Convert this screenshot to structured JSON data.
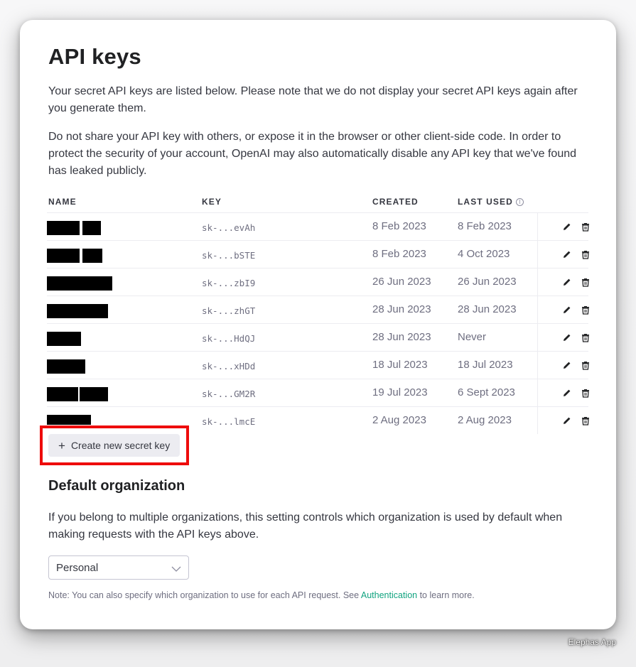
{
  "page": {
    "title": "API keys",
    "intro_1": "Your secret API keys are listed below. Please note that we do not display your secret API keys again after you generate them.",
    "intro_2": "Do not share your API key with others, or expose it in the browser or other client-side code. In order to protect the security of your account, OpenAI may also automatically disable any API key that we've found has leaked publicly."
  },
  "table": {
    "headers": {
      "name": "NAME",
      "key": "KEY",
      "created": "CREATED",
      "last_used": "LAST USED",
      "info_icon": "i"
    },
    "rows": [
      {
        "key": "sk-...evAh",
        "created": "8 Feb 2023",
        "last_used": "8 Feb 2023"
      },
      {
        "key": "sk-...bSTE",
        "created": "8 Feb 2023",
        "last_used": "4 Oct 2023"
      },
      {
        "key": "sk-...zbI9",
        "created": "26 Jun 2023",
        "last_used": "26 Jun 2023"
      },
      {
        "key": "sk-...zhGT",
        "created": "28 Jun 2023",
        "last_used": "28 Jun 2023"
      },
      {
        "key": "sk-...HdQJ",
        "created": "28 Jun 2023",
        "last_used": "Never"
      },
      {
        "key": "sk-...xHDd",
        "created": "18 Jul 2023",
        "last_used": "18 Jul 2023"
      },
      {
        "key": "sk-...GM2R",
        "created": "19 Jul 2023",
        "last_used": "6 Sept 2023"
      },
      {
        "key": "sk-...lmcE",
        "created": "2 Aug 2023",
        "last_used": "2 Aug 2023"
      }
    ],
    "row_icons": {
      "edit": "pencil-icon",
      "delete": "trash-icon"
    }
  },
  "create_button": {
    "icon": "+",
    "label": "Create new secret key",
    "highlight_color": "#ee0b0b"
  },
  "default_org": {
    "heading": "Default organization",
    "description": "If you belong to multiple organizations, this setting controls which organization is used by default when making requests with the API keys above.",
    "selected": "Personal",
    "note_prefix": "Note: You can also specify which organization to use for each API request. See ",
    "note_link": "Authentication",
    "note_suffix": " to learn more."
  },
  "watermark": "Elephas App",
  "colors": {
    "link": "#10a37f",
    "text": "#353740",
    "muted": "#6e6e80"
  }
}
